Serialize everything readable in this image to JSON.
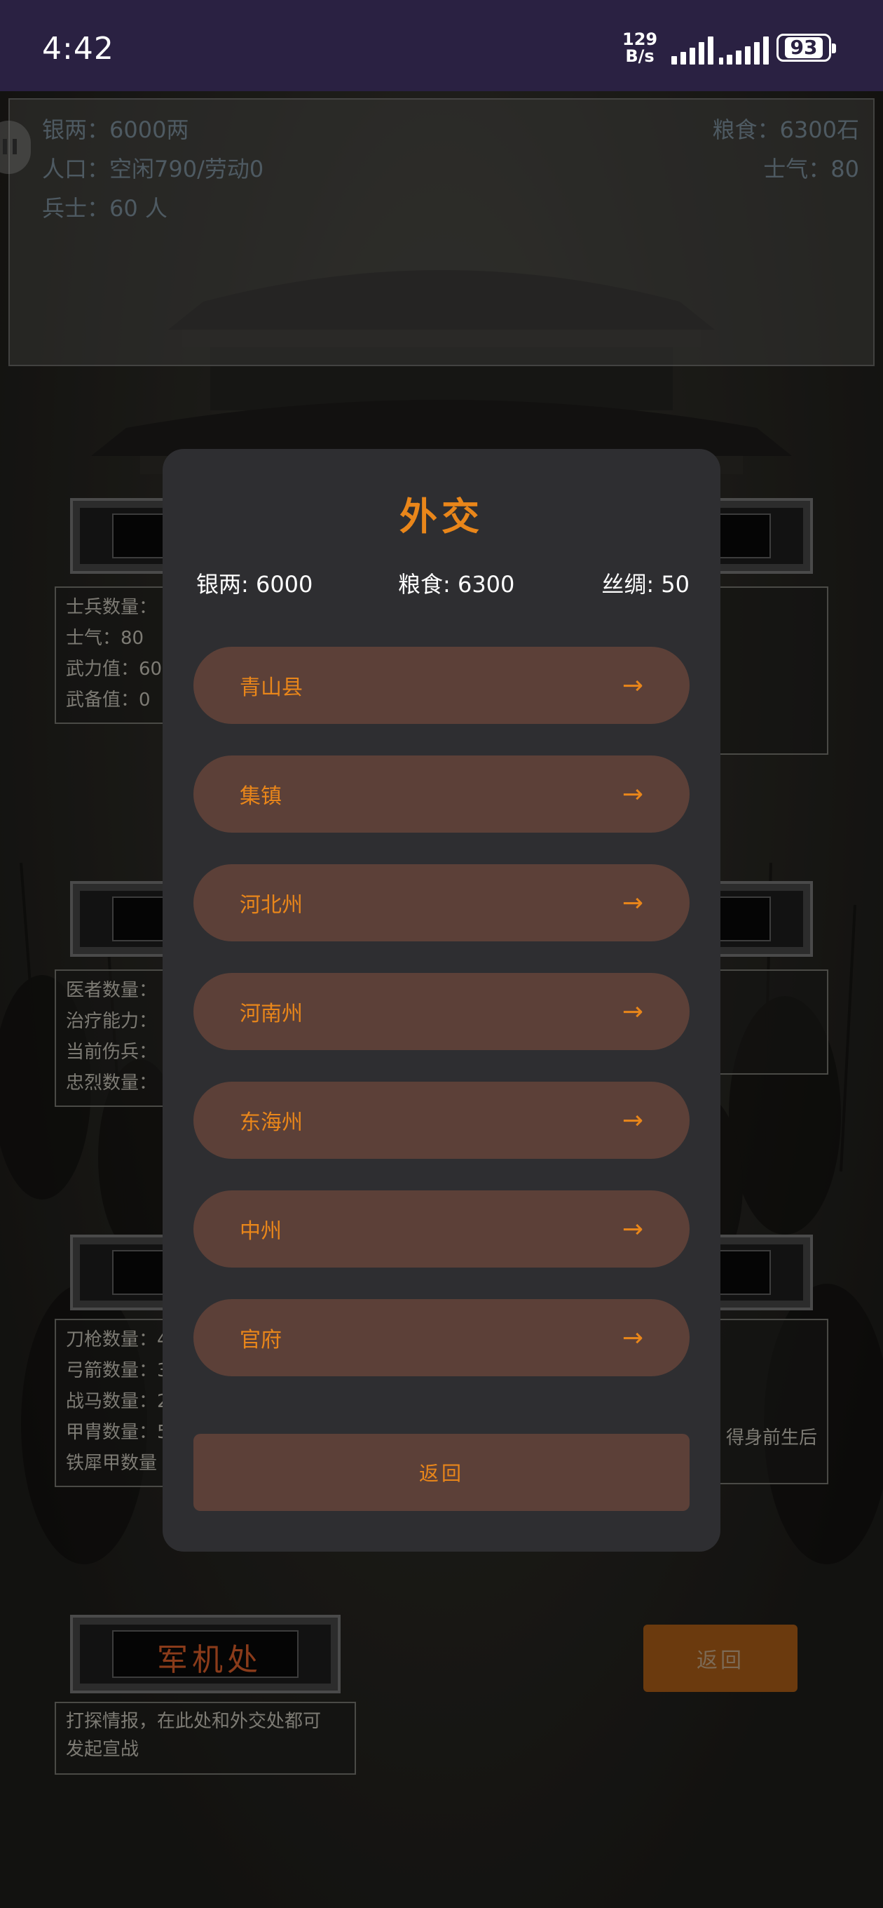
{
  "status_bar": {
    "time": "4:42",
    "net_speed_value": "129",
    "net_speed_unit": "B/s",
    "battery": "93"
  },
  "resources_panel": {
    "silver": "银两：6000两",
    "population": "人口：空闲790/劳动0",
    "soldiers": "兵士：60 人",
    "grain": "粮食：6300石",
    "morale": "士气：80"
  },
  "background_cards": {
    "military_info": [
      "士兵数量：",
      "士气：80",
      "武力值：600",
      "武备值：0"
    ],
    "medical_info": [
      "医者数量：",
      "治疗能力：",
      "当前伤兵：",
      "忠烈数量："
    ],
    "armory_info": [
      "刀枪数量：4",
      "弓箭数量：3",
      "战马数量：2",
      "甲胄数量：5",
      "铁犀甲数量"
    ],
    "right_partial_text": "得身前生后",
    "council_title": "军机处",
    "council_desc_line1": "打探情报，在此处和外交处都可",
    "council_desc_line2": "发起宣战",
    "back_label": "返回"
  },
  "dialog": {
    "title": "外交",
    "resources": {
      "silver": "银两: 6000",
      "grain": "粮食: 6300",
      "silk": "丝绸: 50"
    },
    "destinations": [
      {
        "label": "青山县",
        "arrow": "→"
      },
      {
        "label": "集镇",
        "arrow": "→"
      },
      {
        "label": "河北州",
        "arrow": "→"
      },
      {
        "label": "河南州",
        "arrow": "→"
      },
      {
        "label": "东海州",
        "arrow": "→"
      },
      {
        "label": "中州",
        "arrow": "→"
      },
      {
        "label": "官府",
        "arrow": "→"
      }
    ],
    "back_label": "返回"
  },
  "colors": {
    "accent": "#e9861a",
    "button_bg": "#5c4038",
    "dialog_bg": "#2e2e31",
    "status_bar_bg": "#2a2142"
  }
}
